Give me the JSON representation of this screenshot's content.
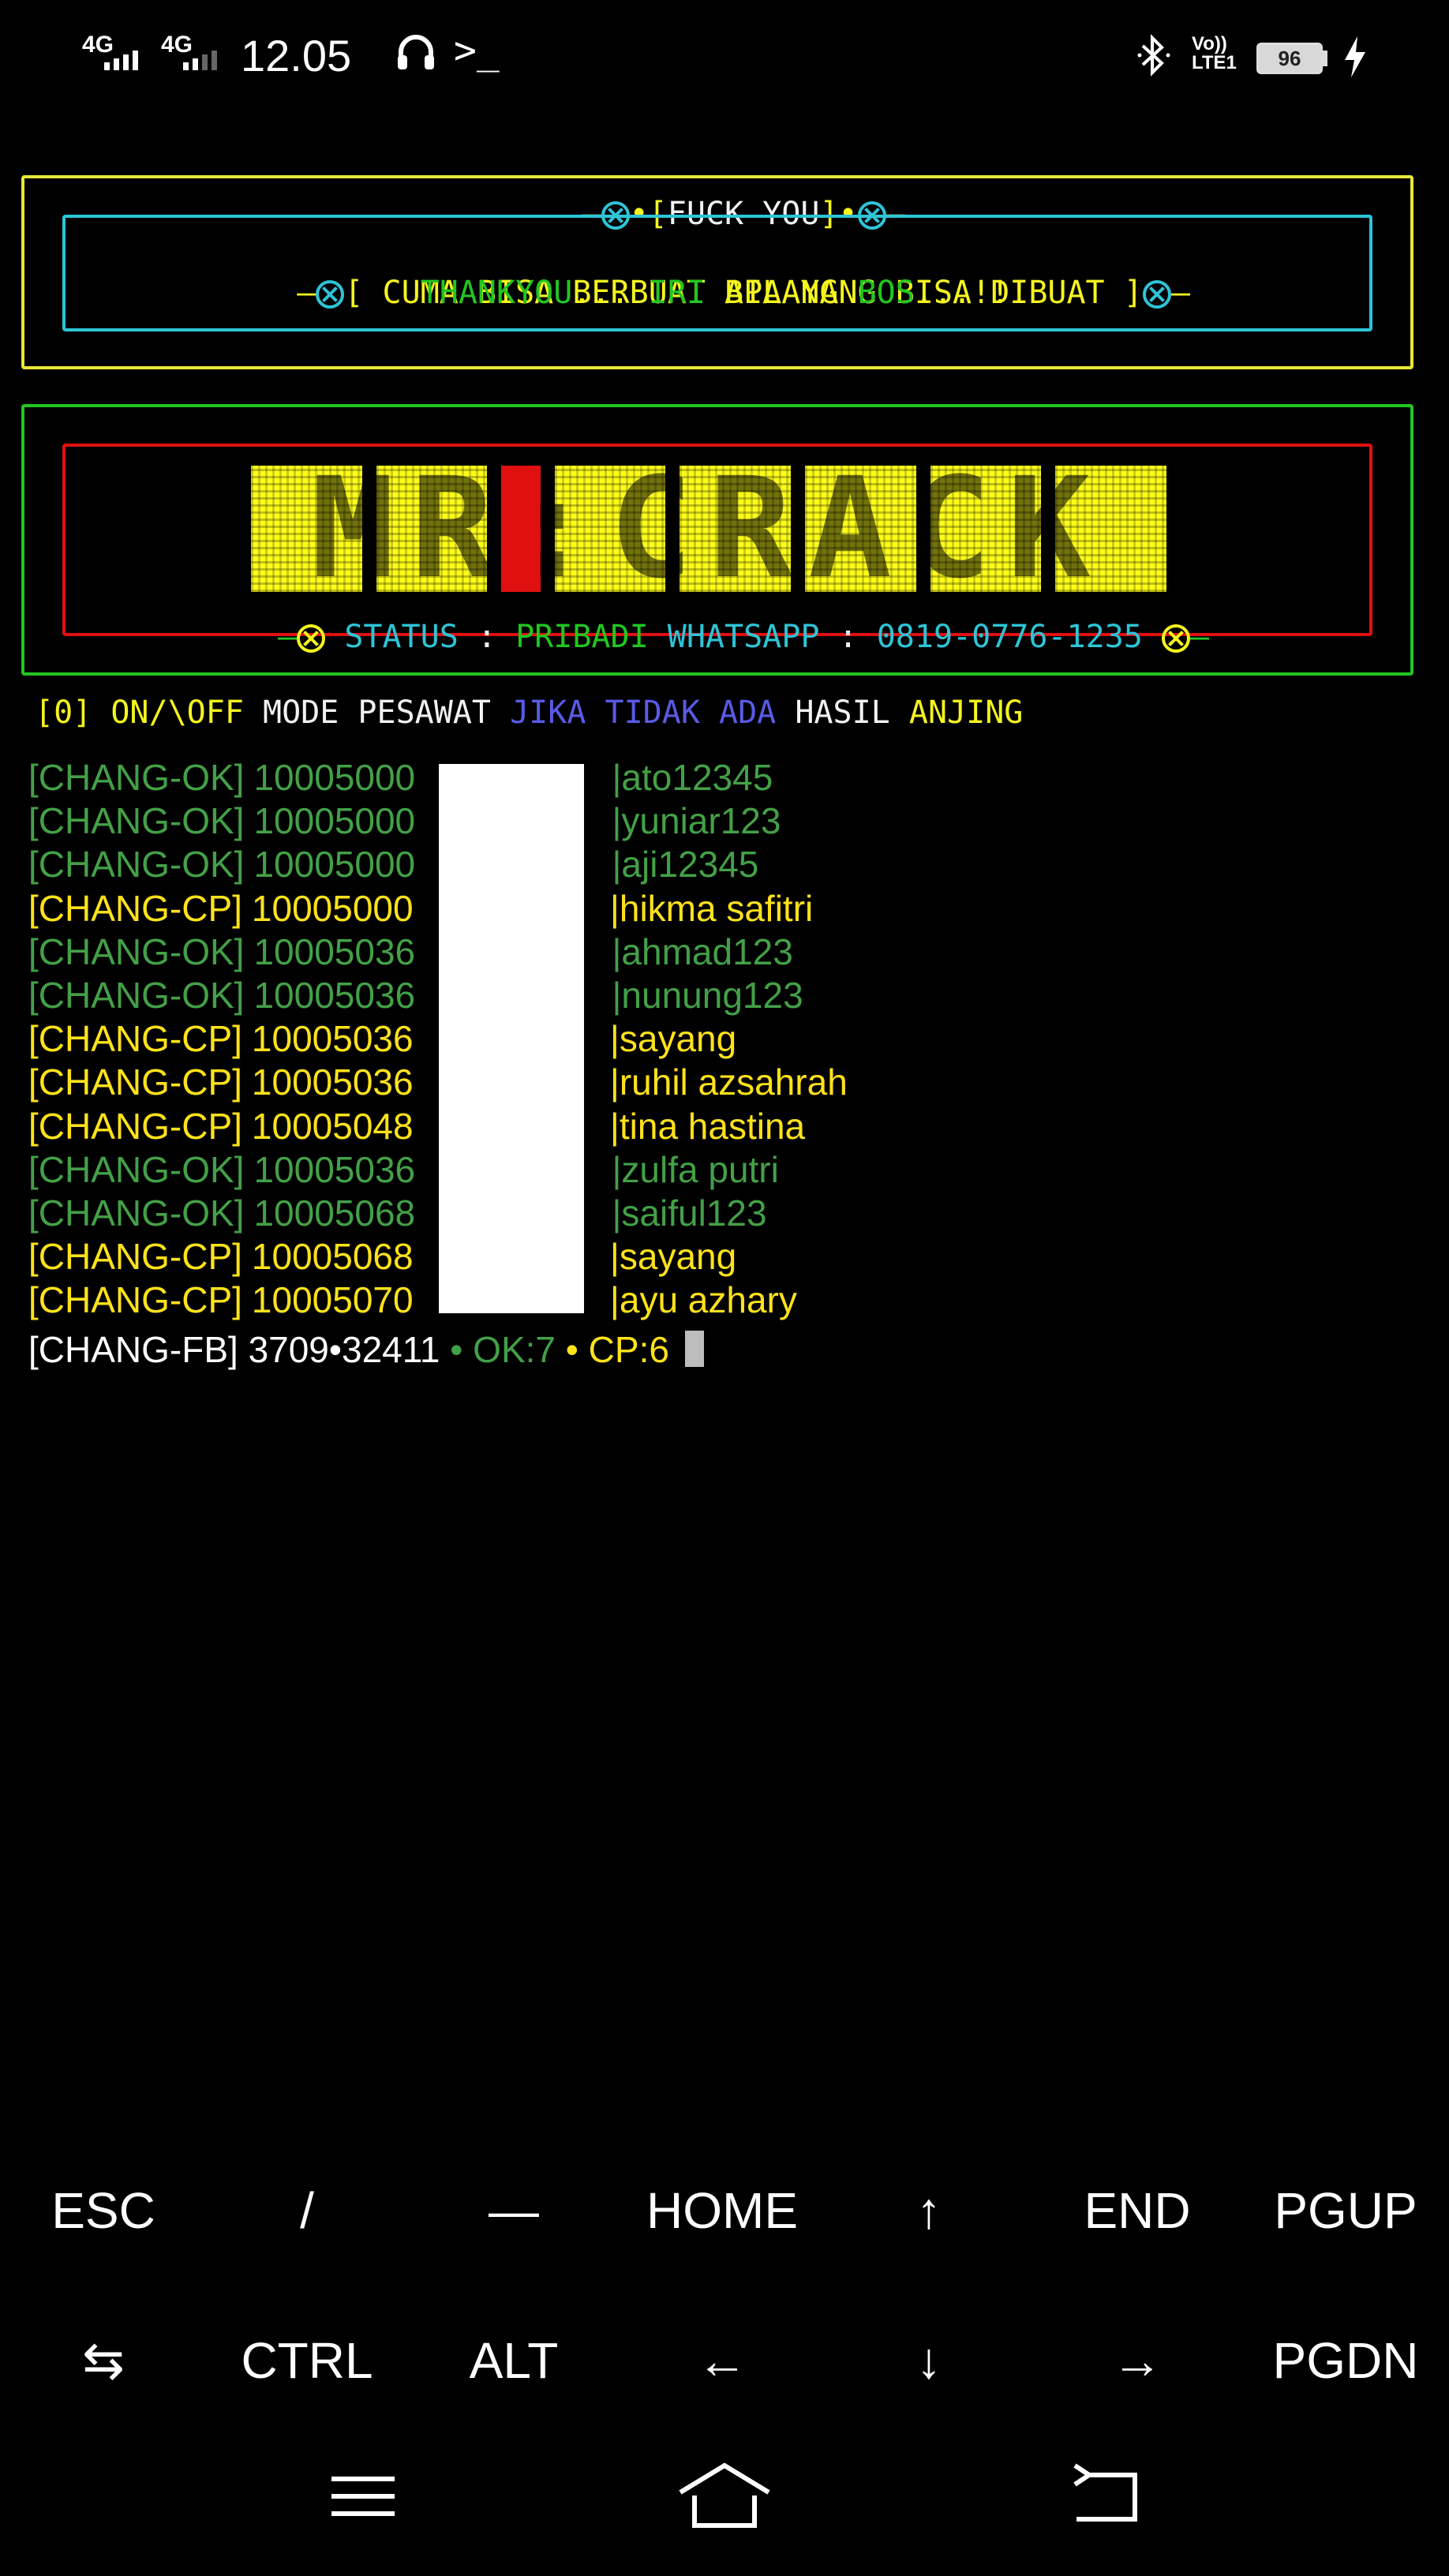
{
  "status_bar": {
    "network1": "4G",
    "network2": "4G",
    "time": "12.05",
    "shell_prompt": ">_",
    "volte_top": "Vo))",
    "volte_bottom": "LTE1",
    "battery": "96",
    "icons": [
      "signal-icon",
      "headset-icon",
      "terminal-icon",
      "bluetooth-icon",
      "volte-icon",
      "battery-icon",
      "charging-icon"
    ]
  },
  "banner1": {
    "title_prefix": "•[",
    "title": "FUCK YOU",
    "title_suffix": "]•",
    "line1": "[ CUMA BISA BERBUAT APA YANG BISA DIBUAT ]",
    "line2_a": "THANKYOU",
    "line2_b": "...",
    "line2_c": "IRI",
    "line2_d": "BILANG",
    "line2_e": "BOS",
    "line2_f": "...!!!"
  },
  "banner2": {
    "logo_text": "MR:CRACK",
    "status_label": "STATUS",
    "sep1": ":",
    "pribadi": "PRIBADI",
    "whatsapp": "WHATSAPP",
    "sep2": ":",
    "phone": "0819-0776-1235"
  },
  "menu": {
    "bracket": "[0]",
    "onoff": "ON/\\OFF",
    "mode": "MODE PESAWAT",
    "jika": "JIKA TIDAK ADA",
    "hasil": "HASIL",
    "anjing": "ANJING"
  },
  "results": [
    {
      "tag": "[CHANG-OK]",
      "id": "10005000",
      "pass": "|ato12345",
      "kind": "ok"
    },
    {
      "tag": "[CHANG-OK]",
      "id": "10005000",
      "pass": "|yuniar123",
      "kind": "ok"
    },
    {
      "tag": "[CHANG-OK]",
      "id": "10005000",
      "pass": "|aji12345",
      "kind": "ok"
    },
    {
      "tag": "[CHANG-CP]",
      "id": "10005000",
      "pass": "|hikma safitri",
      "kind": "cp"
    },
    {
      "tag": "[CHANG-OK]",
      "id": "10005036",
      "pass": "|ahmad123",
      "kind": "ok"
    },
    {
      "tag": "[CHANG-OK]",
      "id": "10005036",
      "pass": "|nunung123",
      "kind": "ok"
    },
    {
      "tag": "[CHANG-CP]",
      "id": "10005036",
      "pass": "|sayang",
      "kind": "cp"
    },
    {
      "tag": "[CHANG-CP]",
      "id": "10005036",
      "pass": "|ruhil azsahrah",
      "kind": "cp"
    },
    {
      "tag": "[CHANG-CP]",
      "id": "10005048",
      "pass": "|tina hastina",
      "kind": "cp"
    },
    {
      "tag": "[CHANG-OK]",
      "id": "10005036",
      "pass": "|zulfa putri",
      "kind": "ok"
    },
    {
      "tag": "[CHANG-OK]",
      "id": "10005068",
      "pass": "|saiful123",
      "kind": "ok"
    },
    {
      "tag": "[CHANG-CP]",
      "id": "10005068",
      "pass": "|sayang",
      "kind": "cp"
    },
    {
      "tag": "[CHANG-CP]",
      "id": "10005070",
      "pass": "|ayu azhary",
      "kind": "cp"
    }
  ],
  "progress_line": {
    "tag": "[CHANG-FB]",
    "count": "3709•32411",
    "ok": "• OK:7",
    "cp": "• CP:6"
  },
  "extra_keys": {
    "row1": [
      "ESC",
      "/",
      "—",
      "HOME",
      "↑",
      "END",
      "PGUP"
    ],
    "row2": [
      "⇆",
      "CTRL",
      "ALT",
      "←",
      "↓",
      "→",
      "PGDN"
    ]
  },
  "nav_icons": [
    "menu-icon",
    "home-icon",
    "back-icon"
  ]
}
